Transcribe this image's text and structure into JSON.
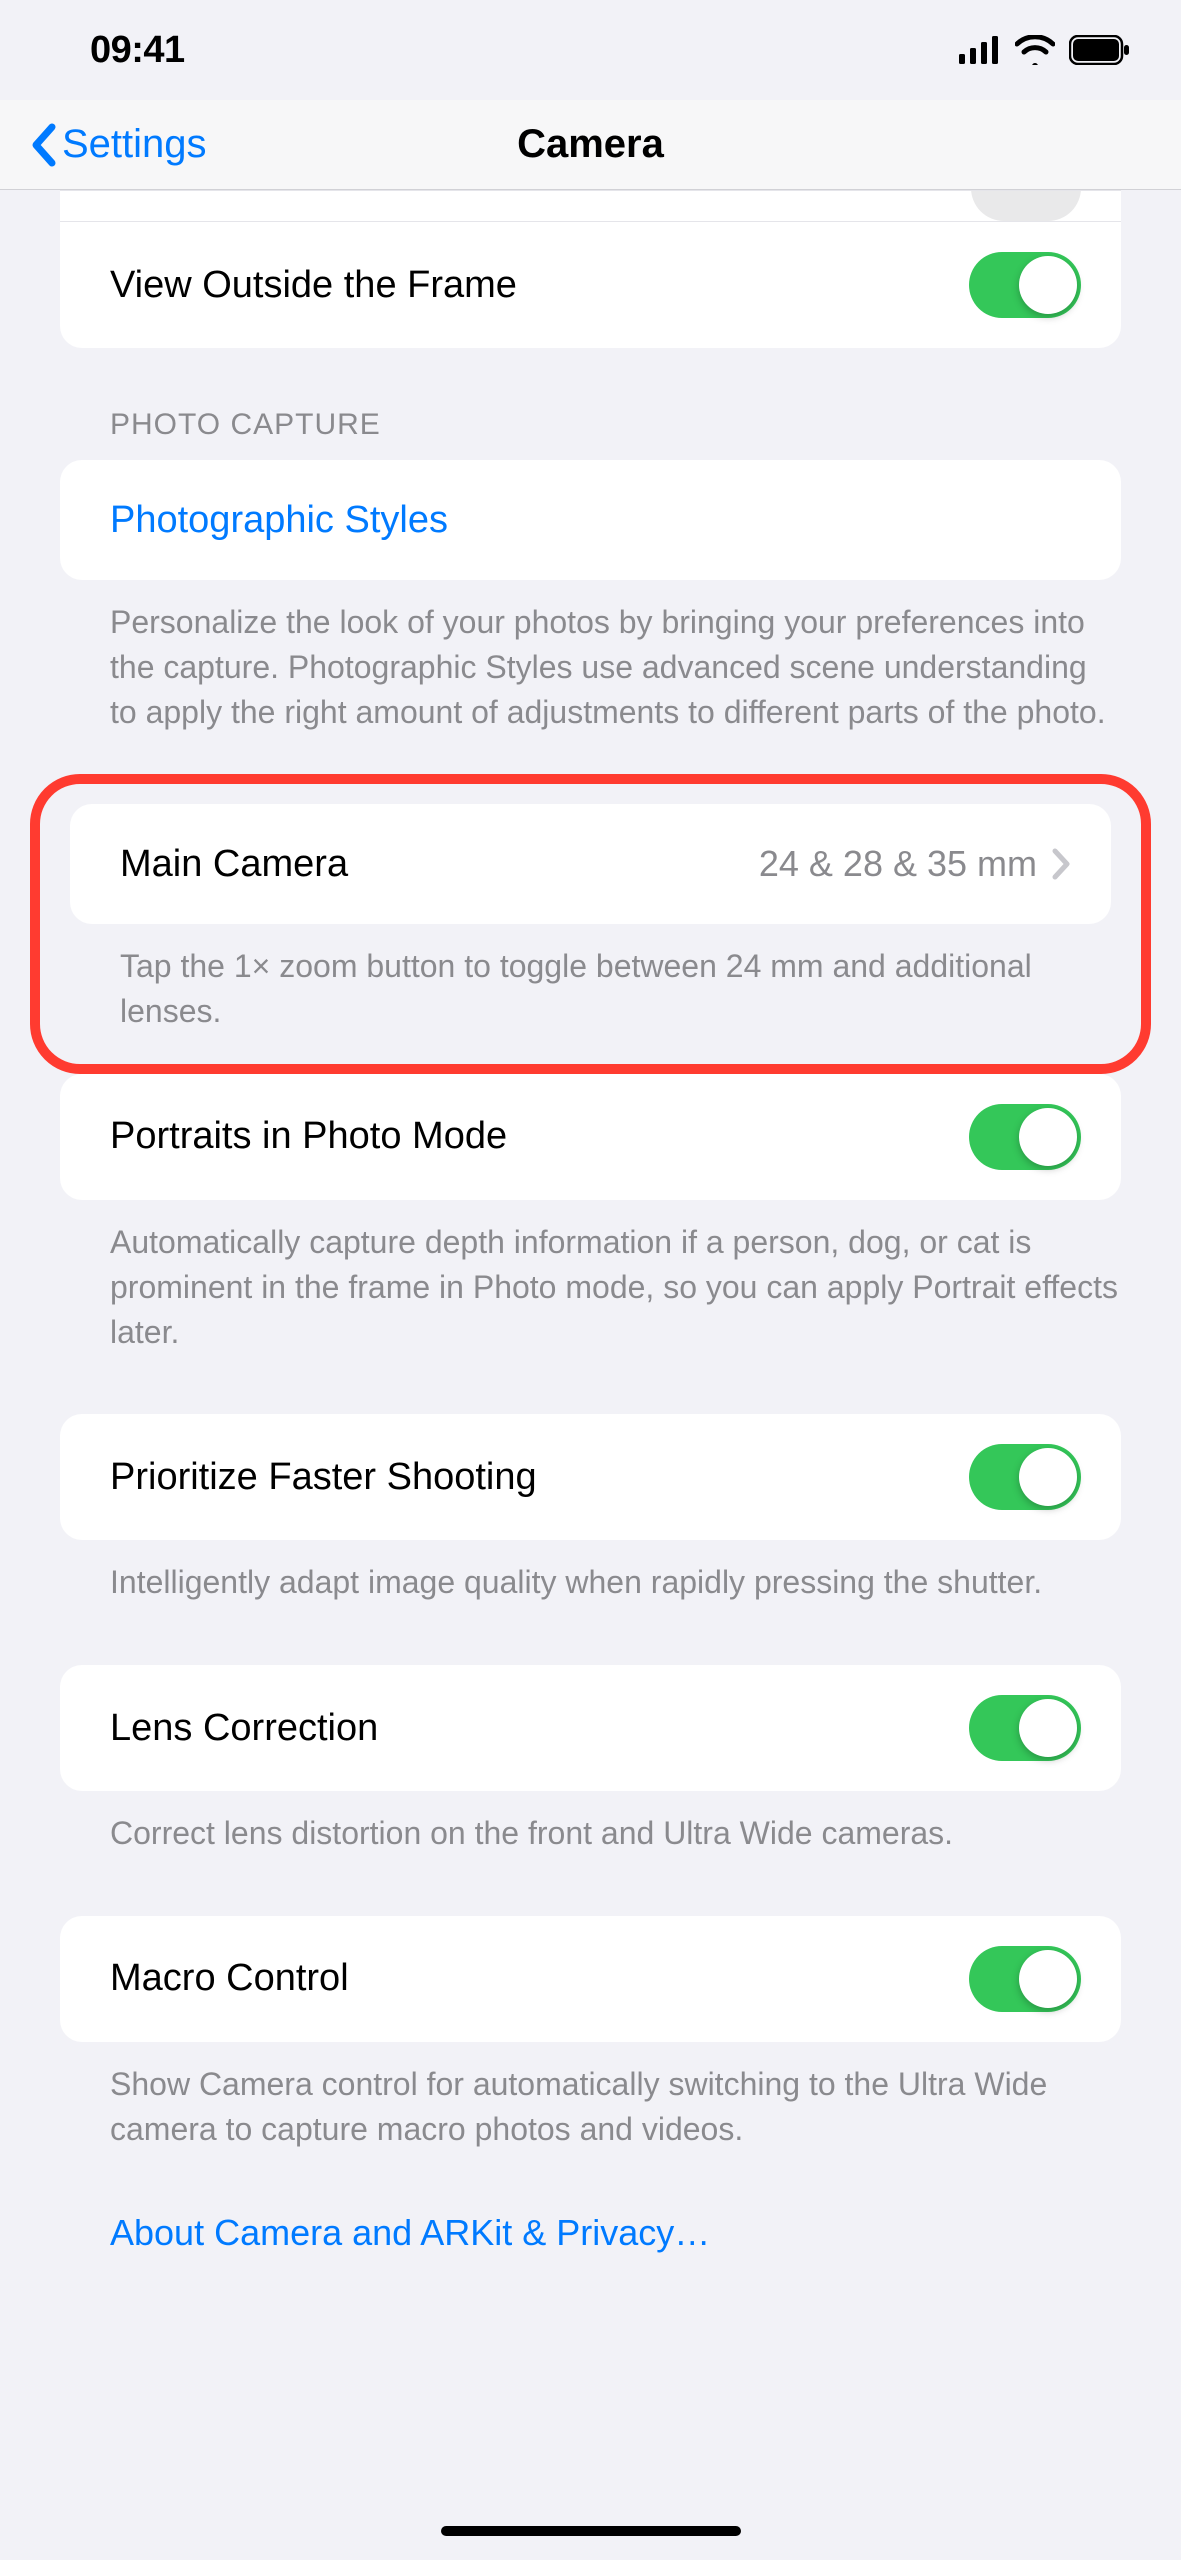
{
  "status": {
    "time": "09:41"
  },
  "nav": {
    "back": "Settings",
    "title": "Camera"
  },
  "view_outside": {
    "label": "View Outside the Frame",
    "on": true
  },
  "photo_capture": {
    "header": "PHOTO CAPTURE",
    "styles_label": "Photographic Styles",
    "styles_footer": "Personalize the look of your photos by bringing your preferences into the capture. Photographic Styles use advanced scene understanding to apply the right amount of adjustments to different parts of the photo."
  },
  "main_camera": {
    "label": "Main Camera",
    "value": "24 & 28 & 35 mm",
    "footer": "Tap the 1× zoom button to toggle between 24 mm and additional lenses."
  },
  "portraits": {
    "label": "Portraits in Photo Mode",
    "on": true,
    "footer": "Automatically capture depth information if a person, dog, or cat is prominent in the frame in Photo mode, so you can apply Portrait effects later."
  },
  "prioritize": {
    "label": "Prioritize Faster Shooting",
    "on": true,
    "footer": "Intelligently adapt image quality when rapidly pressing the shutter."
  },
  "lens_correction": {
    "label": "Lens Correction",
    "on": true,
    "footer": "Correct lens distortion on the front and Ultra Wide cameras."
  },
  "macro": {
    "label": "Macro Control",
    "on": true,
    "footer": "Show Camera control for automatically switching to the Ultra Wide camera to capture macro photos and videos."
  },
  "privacy_link": "About Camera and ARKit & Privacy…"
}
